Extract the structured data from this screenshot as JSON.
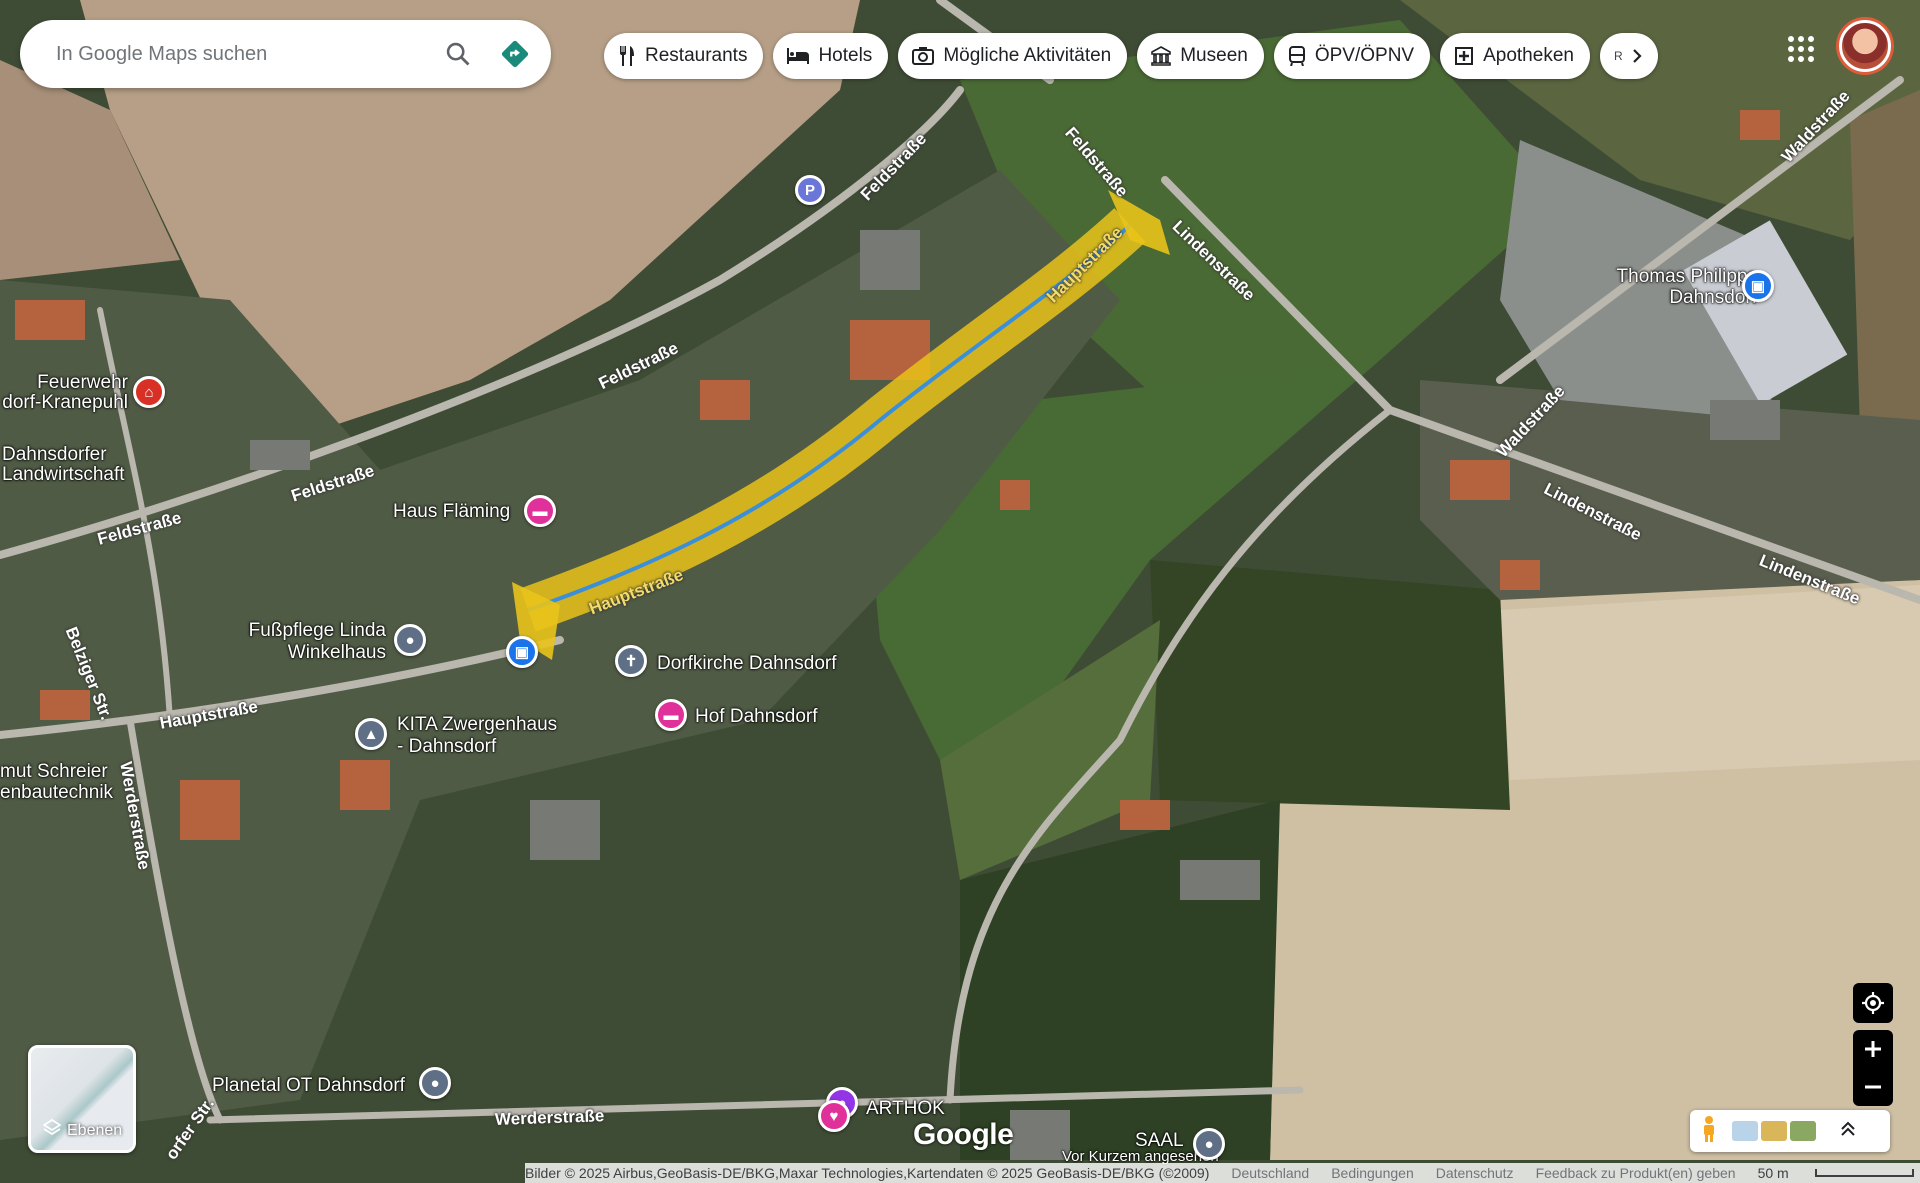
{
  "search": {
    "placeholder": "In Google Maps suchen"
  },
  "chips": [
    {
      "label": "Restaurants",
      "icon": "restaurant-icon"
    },
    {
      "label": "Hotels",
      "icon": "hotel-icon"
    },
    {
      "label": "Mögliche Aktivitäten",
      "icon": "camera-icon"
    },
    {
      "label": "Museen",
      "icon": "museum-icon"
    },
    {
      "label": "ÖPV/ÖPNV",
      "icon": "transit-icon"
    },
    {
      "label": "Apotheken",
      "icon": "pharmacy-icon"
    }
  ],
  "chip_more_text": "RT",
  "places": {
    "feuerwehr": "Feuerwehr\ndorf-Kranepuhl",
    "landwirtschaft": "Dahnsdorfer\nLandwirtschaft",
    "haus_flaeming": "Haus Fläming",
    "fusspflege": "Fußpflege Linda\nWinkelhaus",
    "dorfkirche": "Dorfkirche Dahnsdorf",
    "hof": "Hof Dahnsdorf",
    "kita": "KITA Zwergenhaus\n- Dahnsdorf",
    "schreier": "mut Schreier\nenbautechnik",
    "planetal": "Planetal OT Dahnsdorf",
    "arthok": "ARTHOK",
    "saal": "SAAL",
    "thomas": "Thomas Philipps\nDahnsdorf",
    "parking": "P",
    "recent": "Vor Kurzem angesehen"
  },
  "streets": {
    "feldstrasse": "Feldstraße",
    "lindenstrasse": "Lindenstraße",
    "waldstrasse": "Waldstraße",
    "hauptstrasse": "Hauptstraße",
    "belziger": "Belziger Str.",
    "werderstrasse": "Werderstraße",
    "dorfer": "orfer Str."
  },
  "layers_label": "Ebenen",
  "footer": {
    "copyright": "Bilder © 2025 Airbus,GeoBasis-DE/BKG,Maxar Technologies,Kartendaten © 2025 GeoBasis-DE/BKG (©2009)",
    "country": "Deutschland",
    "terms": "Bedingungen",
    "privacy": "Datenschutz",
    "feedback": "Feedback zu Produkt(en) geben",
    "scale": "50 m"
  },
  "google_logo": "Google",
  "colors": {
    "route_yellow": "#e9c319",
    "route_blue": "#3b8fd8",
    "hotel_pink": "#e0319b",
    "shop_blue": "#1a73e8",
    "fire_red": "#d93025",
    "poi_gray": "#5f6f86"
  }
}
